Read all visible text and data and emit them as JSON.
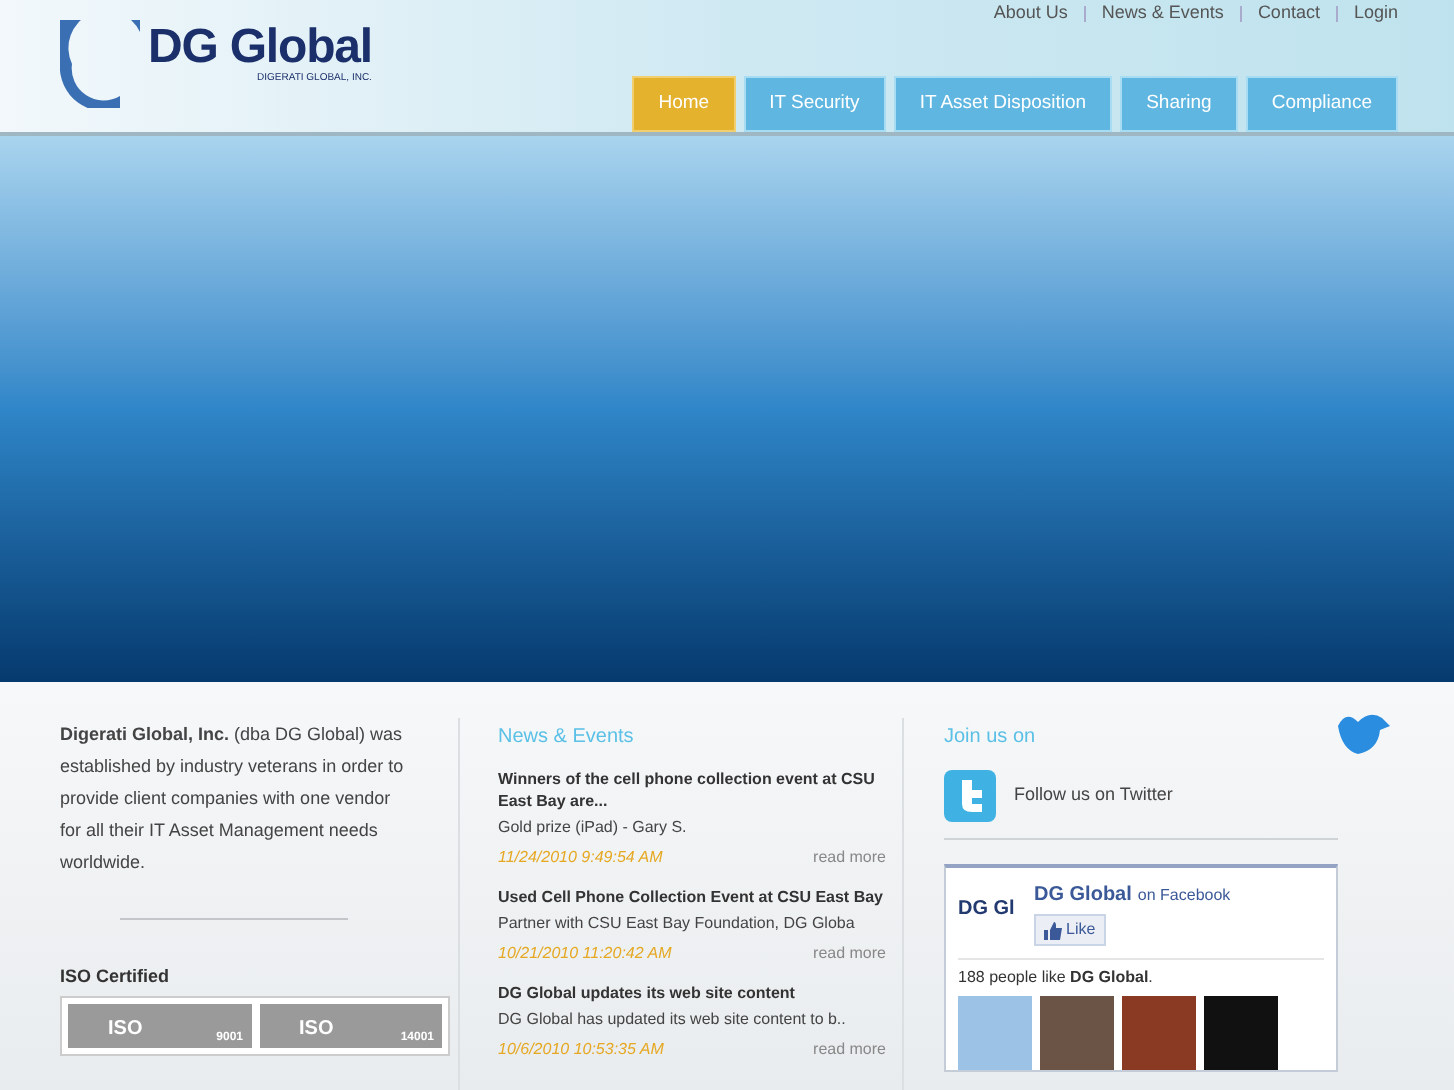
{
  "logo": {
    "name": "DG Global",
    "tagline": "DIGERATI GLOBAL, INC."
  },
  "top_links": [
    "About Us",
    "News & Events",
    "Contact",
    "Login"
  ],
  "nav": [
    {
      "label": "Home",
      "selected": true
    },
    {
      "label": "IT Security",
      "selected": false
    },
    {
      "label": "IT Asset Disposition",
      "selected": false
    },
    {
      "label": "Sharing",
      "selected": false
    },
    {
      "label": "Compliance",
      "selected": false
    }
  ],
  "about": {
    "text": "**Digerati Global, Inc.** (dba DG Global) was established by industry veterans in order to provide client companies with one vendor for all their IT Asset Management needs worldwide."
  },
  "iso": {
    "title": "ISO Certified",
    "badges": [
      {
        "label": "ISO",
        "number": "9001"
      },
      {
        "label": "ISO",
        "number": "14001"
      }
    ]
  },
  "news": {
    "title": "News & Events",
    "items": [
      {
        "title": "Winners of the cell phone collection event at CSU East Bay are...",
        "summary": "Gold prize (iPad) - Gary S.",
        "date": "11/24/2010 9:49:54 AM",
        "more": "read more"
      },
      {
        "title": "Used Cell Phone Collection Event at CSU East Bay",
        "summary": "Partner with CSU East Bay Foundation, DG Globa",
        "date": "10/21/2010 11:20:42 AM",
        "more": "read more"
      },
      {
        "title": "DG Global updates its web site content",
        "summary": "DG Global has updated its web site content to b..",
        "date": "10/6/2010 10:53:35 AM",
        "more": "read more"
      }
    ]
  },
  "social": {
    "title": "Join us on",
    "twitter": "Follow us on Twitter",
    "facebook": {
      "page": "DG Global",
      "suffix": "on Facebook",
      "logo": "DG Gl",
      "like": "Like",
      "count_text": "188 people like **DG Global**.",
      "fans": [
        {
          "kind": "sky"
        },
        {
          "kind": "portrait"
        },
        {
          "kind": "artwork"
        },
        {
          "kind": "dark"
        }
      ]
    }
  }
}
